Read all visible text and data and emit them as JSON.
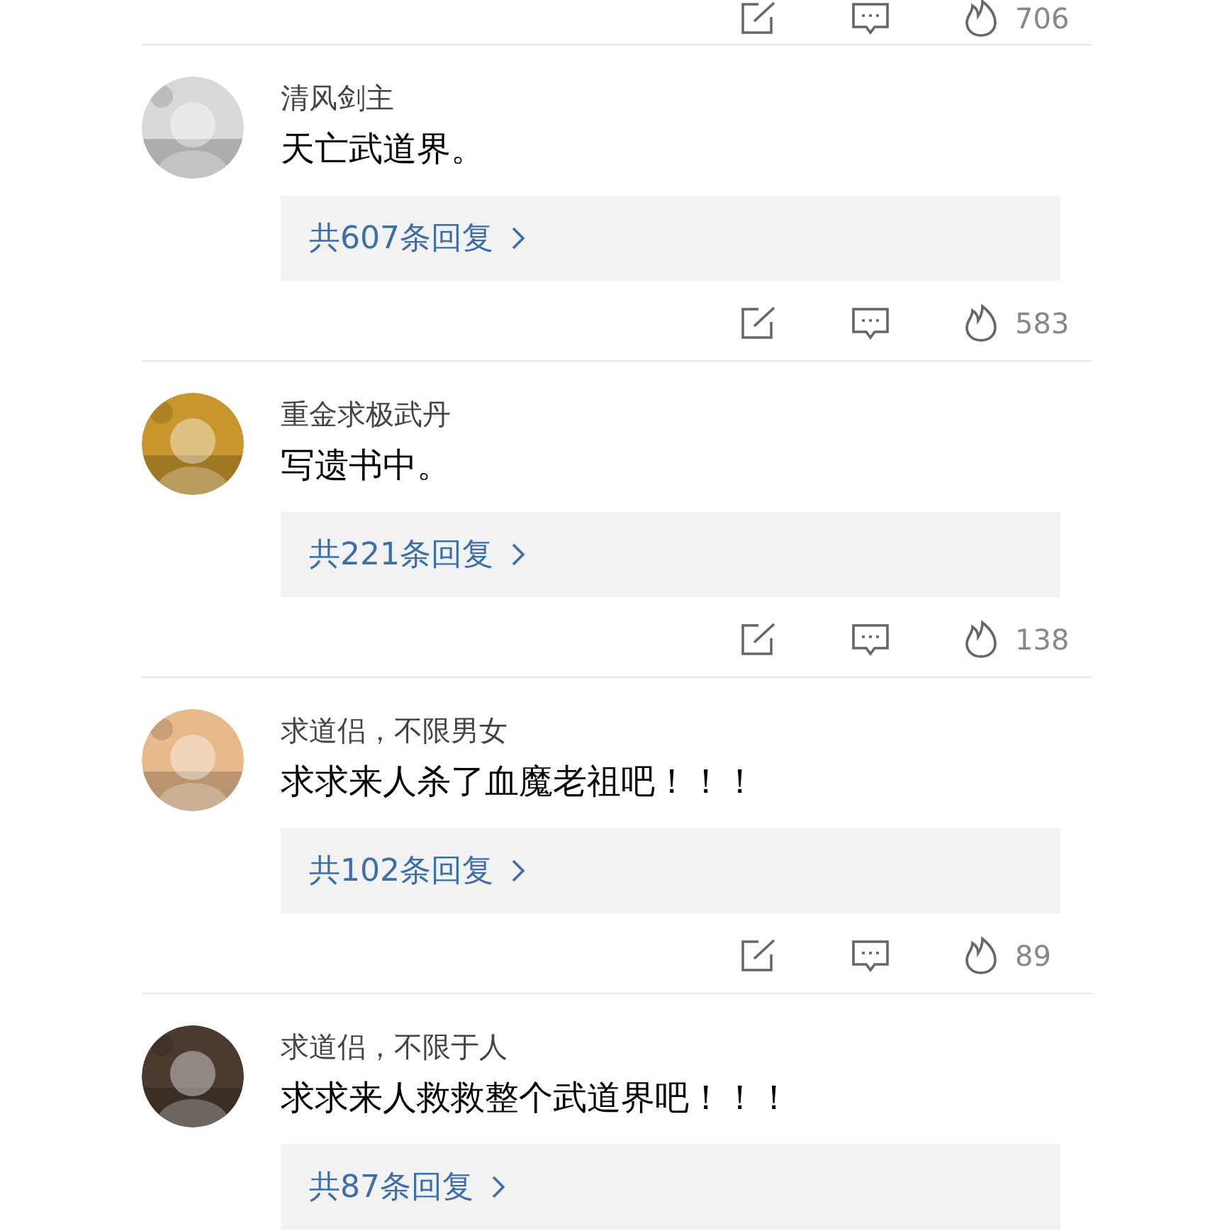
{
  "top_actions": {
    "likes": "706"
  },
  "comments": [
    {
      "user": "清风剑主",
      "text": "天亡武道界。",
      "replies": "共607条回复",
      "likes": "583"
    },
    {
      "user": "重金求极武丹",
      "text": "写遗书中。",
      "replies": "共221条回复",
      "likes": "138"
    },
    {
      "user": "求道侣，不限男女",
      "text": "求求来人杀了血魔老祖吧！！！",
      "replies": "共102条回复",
      "likes": "89"
    },
    {
      "user": "求道侣，不限于人",
      "text": "求求来人救救整个武道界吧！！！",
      "replies": "共87条回复"
    }
  ]
}
